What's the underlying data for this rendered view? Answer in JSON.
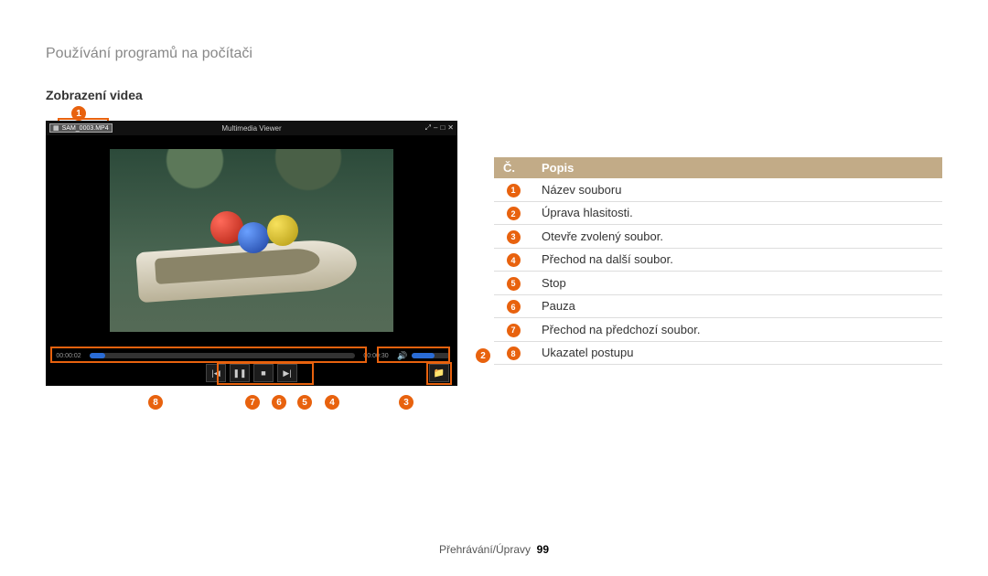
{
  "header": {
    "section_title": "Používání programů na počítači",
    "subtitle": "Zobrazení videa"
  },
  "player": {
    "file_name": "SAM_0003.MP4",
    "app_title": "Multimedia Viewer",
    "time_current": "00:00:02",
    "time_total": "00:00:30"
  },
  "table": {
    "col_num": "Č.",
    "col_desc": "Popis",
    "rows": [
      {
        "n": "1",
        "d": "Název souboru"
      },
      {
        "n": "2",
        "d": "Úprava hlasitosti."
      },
      {
        "n": "3",
        "d": "Otevře zvolený soubor."
      },
      {
        "n": "4",
        "d": "Přechod na další soubor."
      },
      {
        "n": "5",
        "d": "Stop"
      },
      {
        "n": "6",
        "d": "Pauza"
      },
      {
        "n": "7",
        "d": "Přechod na předchozí soubor."
      },
      {
        "n": "8",
        "d": "Ukazatel postupu"
      }
    ]
  },
  "callouts": {
    "c1": "1",
    "c2": "2",
    "c3": "3",
    "c4": "4",
    "c5": "5",
    "c6": "6",
    "c7": "7",
    "c8": "8"
  },
  "footer": {
    "breadcrumb": "Přehrávání/Úpravy",
    "page_num": "99"
  }
}
